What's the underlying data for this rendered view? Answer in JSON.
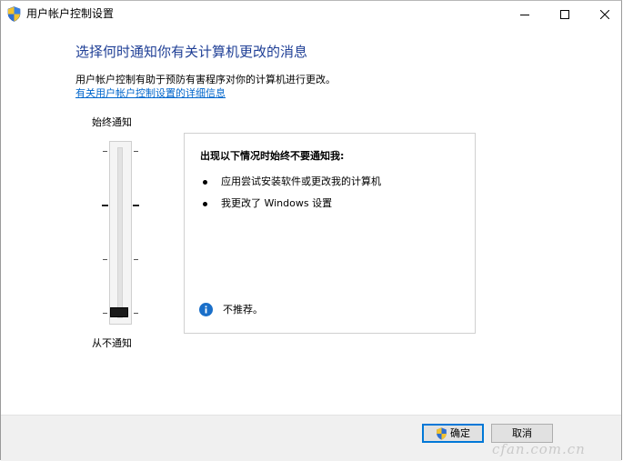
{
  "window": {
    "title": "用户帐户控制设置",
    "icon": "uac-shield-icon"
  },
  "controls": {
    "minimize_icon": "minimize-icon",
    "maximize_icon": "maximize-icon",
    "close_icon": "close-icon"
  },
  "main": {
    "heading": "选择何时通知你有关计算机更改的消息",
    "description": "用户帐户控制有助于预防有害程序对你的计算机进行更改。",
    "link": "有关用户帐户控制设置的详细信息"
  },
  "slider": {
    "top_label": "始终通知",
    "bottom_label": "从不通知",
    "levels": 4,
    "selected_level": 0
  },
  "info": {
    "title": "出现以下情况时始终不要通知我:",
    "bullets": [
      "应用尝试安装软件或更改我的计算机",
      "我更改了 Windows 设置"
    ],
    "recommendation": "不推荐。",
    "recommendation_icon": "info-icon"
  },
  "footer": {
    "ok_label": "确定",
    "cancel_label": "取消"
  },
  "watermark": {
    "text": "cfan.com.cn"
  },
  "colors": {
    "heading": "#1f3f96",
    "link": "#0066cc",
    "accent": "#0078d7",
    "info_icon": "#1a6fc9"
  }
}
